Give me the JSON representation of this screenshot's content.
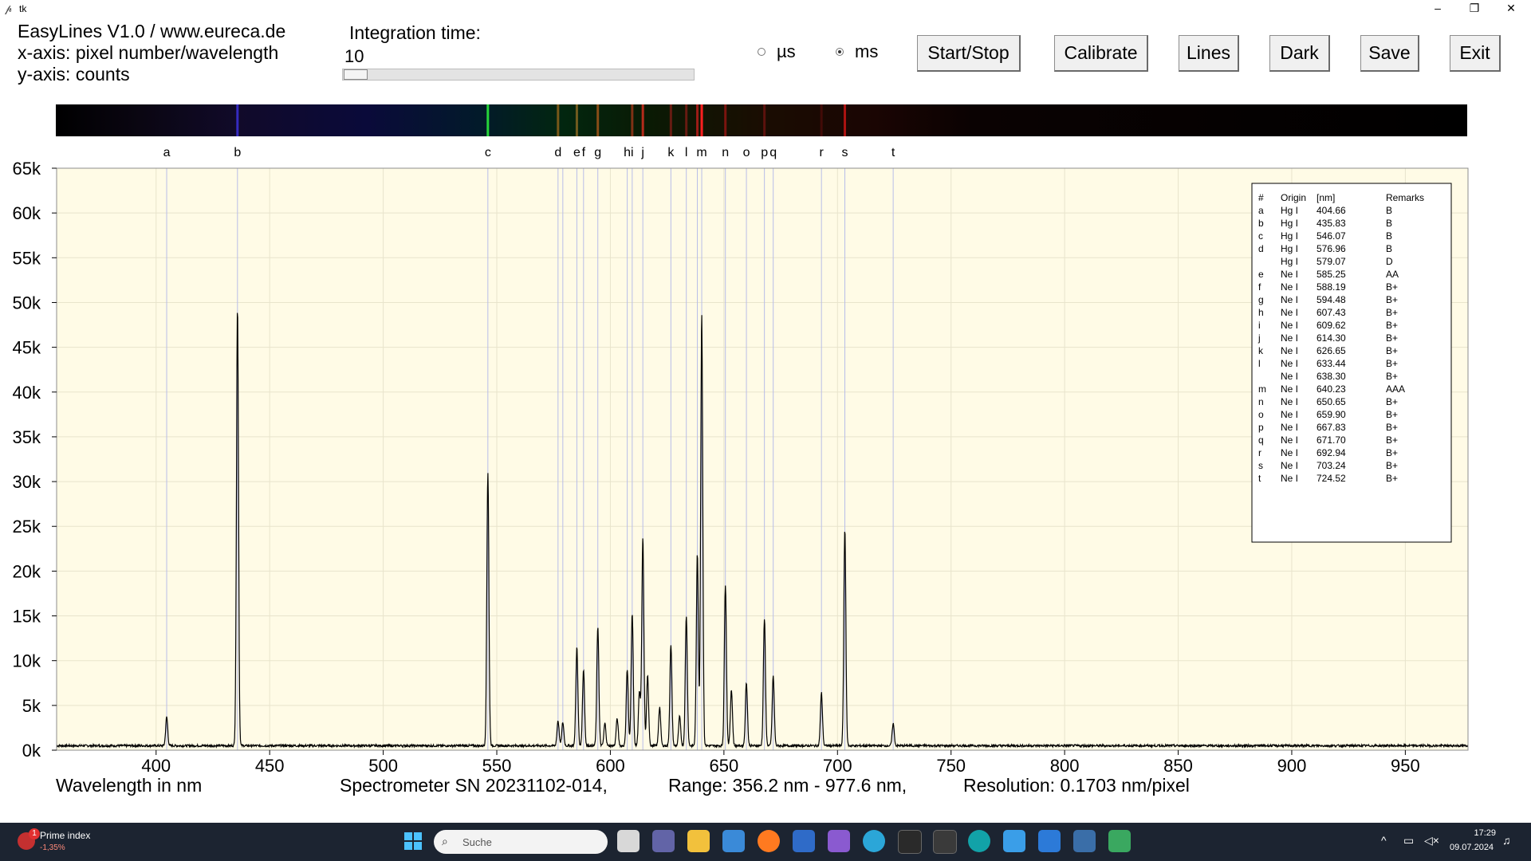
{
  "window": {
    "title": "tk",
    "controls": [
      "–",
      "❐",
      "✕"
    ]
  },
  "header": {
    "info_lines": [
      "EasyLines V1.0 / www.eureca.de",
      "x-axis: pixel number/wavelength",
      "y-axis: counts"
    ],
    "integration_label": "Integration time:",
    "integration_value": "10",
    "integration_slider_fraction": 0.0,
    "unit_us": "µs",
    "unit_ms": "ms",
    "unit_selected": "ms",
    "buttons": {
      "start_stop": "Start/Stop",
      "calibrate": "Calibrate",
      "lines": "Lines",
      "dark": "Dark",
      "save": "Save",
      "exit": "Exit"
    }
  },
  "footer": {
    "xlabel": "Wavelength in nm",
    "spectrometer": "Spectrometer SN 20231102-014,",
    "range": "Range: 356.2 nm - 977.6 nm,",
    "resolution": "Resolution: 0.1703 nm/pixel"
  },
  "line_table": {
    "headers": [
      "#",
      "Origin",
      "[nm]",
      "Remarks"
    ],
    "rows": [
      [
        "a",
        "Hg I",
        "404.66",
        "B"
      ],
      [
        "b",
        "Hg I",
        "435.83",
        "B"
      ],
      [
        "c",
        "Hg I",
        "546.07",
        "B"
      ],
      [
        "d",
        "Hg I",
        "576.96",
        "B"
      ],
      [
        "",
        "Hg I",
        "579.07",
        "D"
      ],
      [
        "e",
        "Ne I",
        "585.25",
        "AA"
      ],
      [
        "f",
        "Ne I",
        "588.19",
        "B+"
      ],
      [
        "g",
        "Ne I",
        "594.48",
        "B+"
      ],
      [
        "h",
        "Ne I",
        "607.43",
        "B+"
      ],
      [
        "i",
        "Ne I",
        "609.62",
        "B+"
      ],
      [
        "j",
        "Ne I",
        "614.30",
        "B+"
      ],
      [
        "k",
        "Ne I",
        "626.65",
        "B+"
      ],
      [
        "l",
        "Ne I",
        "633.44",
        "B+"
      ],
      [
        "",
        "Ne I",
        "638.30",
        "B+"
      ],
      [
        "m",
        "Ne I",
        "640.23",
        "AAA"
      ],
      [
        "n",
        "Ne I",
        "650.65",
        "B+"
      ],
      [
        "o",
        "Ne I",
        "659.90",
        "B+"
      ],
      [
        "p",
        "Ne I",
        "667.83",
        "B+"
      ],
      [
        "q",
        "Ne I",
        "671.70",
        "B+"
      ],
      [
        "r",
        "Ne I",
        "692.94",
        "B+"
      ],
      [
        "s",
        "Ne I",
        "703.24",
        "B+"
      ],
      [
        "t",
        "Ne I",
        "724.52",
        "B+"
      ]
    ]
  },
  "chart_data": {
    "type": "line",
    "xlabel": "Wavelength in nm",
    "ylabel": "",
    "xlim": [
      356.2,
      977.6
    ],
    "ylim": [
      0,
      65000
    ],
    "x_ticks": [
      400,
      450,
      500,
      550,
      600,
      650,
      700,
      750,
      800,
      850,
      900,
      950
    ],
    "y_ticks": [
      0,
      5000,
      10000,
      15000,
      20000,
      25000,
      30000,
      35000,
      40000,
      45000,
      50000,
      55000,
      60000,
      65000
    ],
    "y_tick_labels": [
      "0k",
      "5k",
      "10k",
      "15k",
      "20k",
      "25k",
      "30k",
      "35k",
      "40k",
      "45k",
      "50k",
      "55k",
      "60k",
      "65k"
    ],
    "grid": true,
    "baseline_counts": 500,
    "peaks": [
      {
        "x": 404.66,
        "y": 3200
      },
      {
        "x": 435.83,
        "y": 49000
      },
      {
        "x": 546.07,
        "y": 30500
      },
      {
        "x": 576.96,
        "y": 2800
      },
      {
        "x": 579.07,
        "y": 2600
      },
      {
        "x": 585.25,
        "y": 11000
      },
      {
        "x": 588.19,
        "y": 8500
      },
      {
        "x": 594.48,
        "y": 13300
      },
      {
        "x": 597.6,
        "y": 2500
      },
      {
        "x": 603.0,
        "y": 3000
      },
      {
        "x": 607.43,
        "y": 8500
      },
      {
        "x": 609.62,
        "y": 14800
      },
      {
        "x": 612.8,
        "y": 6000
      },
      {
        "x": 614.3,
        "y": 23300
      },
      {
        "x": 616.4,
        "y": 7800
      },
      {
        "x": 621.7,
        "y": 4300
      },
      {
        "x": 626.65,
        "y": 11200
      },
      {
        "x": 630.5,
        "y": 3300
      },
      {
        "x": 633.44,
        "y": 14500
      },
      {
        "x": 638.3,
        "y": 21500
      },
      {
        "x": 640.23,
        "y": 48300
      },
      {
        "x": 650.65,
        "y": 18000
      },
      {
        "x": 653.3,
        "y": 6300
      },
      {
        "x": 659.9,
        "y": 7100
      },
      {
        "x": 667.83,
        "y": 14200
      },
      {
        "x": 671.7,
        "y": 7800
      },
      {
        "x": 692.94,
        "y": 5900
      },
      {
        "x": 703.24,
        "y": 24200
      },
      {
        "x": 724.52,
        "y": 2500
      }
    ],
    "marker_lines": [
      {
        "label": "a",
        "x": 404.66
      },
      {
        "label": "b",
        "x": 435.83
      },
      {
        "label": "c",
        "x": 546.07
      },
      {
        "label": "d",
        "x": 576.96
      },
      {
        "label": "",
        "x": 579.07
      },
      {
        "label": "e",
        "x": 585.25
      },
      {
        "label": "f",
        "x": 588.19
      },
      {
        "label": "g",
        "x": 594.48
      },
      {
        "label": "h",
        "x": 607.43
      },
      {
        "label": "i",
        "x": 609.62
      },
      {
        "label": "j",
        "x": 614.3
      },
      {
        "label": "k",
        "x": 626.65
      },
      {
        "label": "l",
        "x": 633.44
      },
      {
        "label": "",
        "x": 638.3
      },
      {
        "label": "m",
        "x": 640.23
      },
      {
        "label": "n",
        "x": 650.65
      },
      {
        "label": "o",
        "x": 659.9
      },
      {
        "label": "p",
        "x": 667.83
      },
      {
        "label": "q",
        "x": 671.7
      },
      {
        "label": "r",
        "x": 692.94
      },
      {
        "label": "s",
        "x": 703.24
      },
      {
        "label": "t",
        "x": 724.52
      }
    ],
    "line_color": "#000000",
    "marker_color": "#b8bde8",
    "plot_background": "#fffbe6"
  },
  "spectrum_bands": [
    {
      "x": 435.83,
      "color": "#3a2fd0",
      "intensity": 0.9
    },
    {
      "x": 546.07,
      "color": "#25d43a",
      "intensity": 1.0
    },
    {
      "x": 576.96,
      "color": "#c87a20",
      "intensity": 0.6
    },
    {
      "x": 585.25,
      "color": "#e09030",
      "intensity": 0.5
    },
    {
      "x": 594.48,
      "color": "#e06a20",
      "intensity": 0.6
    },
    {
      "x": 609.62,
      "color": "#d04020",
      "intensity": 0.6
    },
    {
      "x": 614.3,
      "color": "#e03020",
      "intensity": 0.8
    },
    {
      "x": 626.65,
      "color": "#c02020",
      "intensity": 0.5
    },
    {
      "x": 633.44,
      "color": "#c02020",
      "intensity": 0.5
    },
    {
      "x": 638.3,
      "color": "#d82020",
      "intensity": 0.7
    },
    {
      "x": 640.23,
      "color": "#ff2020",
      "intensity": 1.0
    },
    {
      "x": 650.65,
      "color": "#c01818",
      "intensity": 0.6
    },
    {
      "x": 667.83,
      "color": "#a01818",
      "intensity": 0.5
    },
    {
      "x": 692.94,
      "color": "#801010",
      "intensity": 0.4
    },
    {
      "x": 703.24,
      "color": "#d01515",
      "intensity": 0.8
    }
  ],
  "taskbar": {
    "widget_title": "Prime index",
    "widget_value": "-1,35%",
    "widget_badge": "1",
    "search_placeholder": "Suche",
    "time": "17:29",
    "date": "09.07.2024",
    "icons": [
      "start-icon",
      "search-icon",
      "task-view-icon",
      "teams-icon",
      "file-explorer-icon",
      "store-icon",
      "firefox-icon",
      "outlook-icon",
      "visual-studio-icon",
      "edge-icon",
      "terminal-icon",
      "powershell-icon",
      "arduino-icon",
      "notepad-icon",
      "paint-icon",
      "python-icon",
      "snipping-icon"
    ]
  }
}
